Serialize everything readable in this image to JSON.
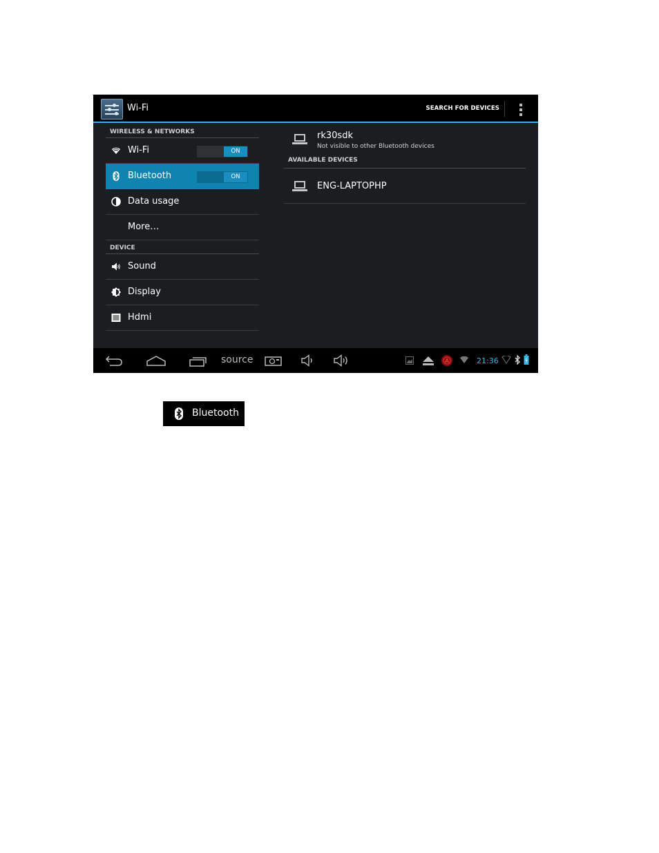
{
  "actionbar": {
    "title": "Wi-Fi",
    "search_label": "SEARCH FOR DEVICES",
    "icon": "settings-icon"
  },
  "left_pane": {
    "section_wireless": "WIRELESS & NETWORKS",
    "wifi": {
      "label": "Wi-Fi",
      "toggle": "ON"
    },
    "bluetooth": {
      "label": "Bluetooth",
      "toggle": "ON"
    },
    "data_usage": "Data usage",
    "more": "More…",
    "section_device": "DEVICE",
    "sound": "Sound",
    "display": "Display",
    "hdmi": "Hdmi"
  },
  "right_pane": {
    "own_device": {
      "name": "rk30sdk",
      "status": "Not visible to other Bluetooth devices"
    },
    "available_header": "AVAILABLE DEVICES",
    "available": [
      {
        "name": "ENG-LAPTOPHP"
      }
    ]
  },
  "navbar": {
    "source_label": "source",
    "clock": "21:36"
  },
  "callout": {
    "label": "Bluetooth",
    "icon": "bluetooth-icon"
  },
  "colors": {
    "accent": "#33b5e5",
    "selected": "#0f84b0",
    "background": "#1b1d20"
  }
}
